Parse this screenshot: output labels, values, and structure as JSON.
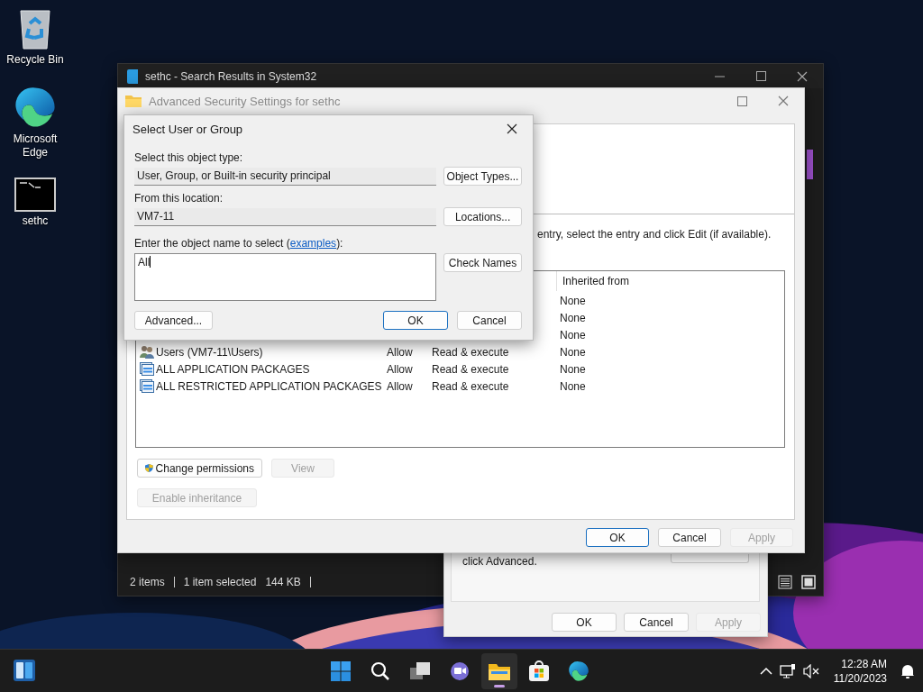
{
  "desktop_icons": [
    {
      "label": "Recycle Bin",
      "kind": "recycle"
    },
    {
      "label": "Microsoft Edge",
      "kind": "edge"
    },
    {
      "label": "sethc",
      "kind": "console"
    }
  ],
  "explorer_window": {
    "title": "sethc - Search Results in System32",
    "status_bar": {
      "item_count": "2 items",
      "selection": "1 item selected",
      "size": "144 KB"
    }
  },
  "properties_window": {
    "text": "click Advanced.",
    "buttons": [
      {
        "label": "OK",
        "disabled": false
      },
      {
        "label": "Cancel",
        "disabled": false
      },
      {
        "label": "Apply",
        "disabled": true
      }
    ]
  },
  "advanced_security_window": {
    "title": "Advanced Security Settings for sethc",
    "instruction": "entry, select the entry and click Edit (if available).",
    "table": {
      "columns": [
        {
          "label": "Inherited from"
        }
      ],
      "rows": [
        {
          "inherited_from": "None"
        },
        {
          "inherited_from": "None"
        },
        {
          "inherited_from": "None"
        },
        {
          "kind": "group",
          "column_1": "Users (VM7-11\\Users)",
          "column_2": "Allow",
          "column_3": "Read & execute",
          "inherited_from": "None"
        },
        {
          "kind": "package",
          "column_1": "ALL APPLICATION PACKAGES",
          "column_2": "Allow",
          "column_3": "Read & execute",
          "inherited_from": "None"
        },
        {
          "kind": "package",
          "column_1": "ALL RESTRICTED APPLICATION PACKAGES",
          "column_2": "Allow",
          "column_3": "Read & execute",
          "inherited_from": "None"
        }
      ]
    },
    "change_permissions_button": {
      "label": "Change permissions",
      "disabled": false
    },
    "view_button": {
      "label": "View",
      "disabled": true
    },
    "enable_inheritance_button": {
      "label": "Enable inheritance",
      "disabled": true
    },
    "buttons": [
      {
        "label": "OK",
        "default": true,
        "disabled": false
      },
      {
        "label": "Cancel",
        "default": false,
        "disabled": false
      },
      {
        "label": "Apply",
        "default": false,
        "disabled": true
      }
    ]
  },
  "select_dialog": {
    "title": "Select User or Group",
    "object_type_label": "Select this object type:",
    "object_type": "User, Group, or Built-in security principal",
    "object_types_button": "Object Types...",
    "location_label": "From this location:",
    "location": "VM7-11",
    "locations_button": "Locations...",
    "name_label_before": "Enter the object name to select (",
    "name_link": "examples",
    "name_label_after": "):",
    "name_value": "All",
    "check_names_button": "Check Names",
    "advanced_button": "Advanced...",
    "buttons": [
      {
        "label": "OK",
        "default": true
      },
      {
        "label": "Cancel",
        "default": false
      }
    ]
  },
  "taskbar": {
    "apps": [
      {
        "kind": "start",
        "active": false
      },
      {
        "kind": "search",
        "active": false
      },
      {
        "kind": "task-view",
        "active": false
      },
      {
        "kind": "chat",
        "active": false
      },
      {
        "kind": "file-explorer",
        "active": true
      },
      {
        "kind": "store",
        "active": false
      },
      {
        "kind": "edge",
        "active": false
      }
    ],
    "time": "12:28 AM",
    "date": "11/20/2023"
  }
}
